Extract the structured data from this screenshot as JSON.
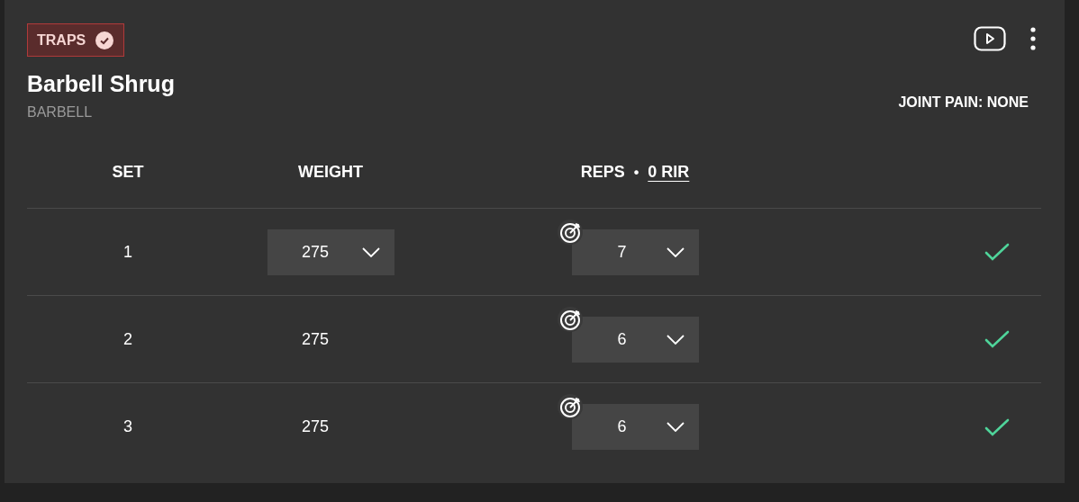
{
  "muscle_tag": {
    "label": "TRAPS",
    "checked": true
  },
  "exercise": {
    "name": "Barbell Shrug",
    "equipment": "BARBELL"
  },
  "joint_pain": "JOINT PAIN: NONE",
  "columns": {
    "set": "SET",
    "weight": "WEIGHT",
    "reps": "REPS",
    "separator": "•",
    "rir": "0 RIR"
  },
  "sets": [
    {
      "set": "1",
      "weight": {
        "kind": "dropdown",
        "value": "275"
      },
      "reps": "7",
      "done": true
    },
    {
      "set": "2",
      "weight": {
        "kind": "text",
        "value": "275"
      },
      "reps": "6",
      "done": true
    },
    {
      "set": "3",
      "weight": {
        "kind": "text",
        "value": "275"
      },
      "reps": "6",
      "done": true
    }
  ]
}
